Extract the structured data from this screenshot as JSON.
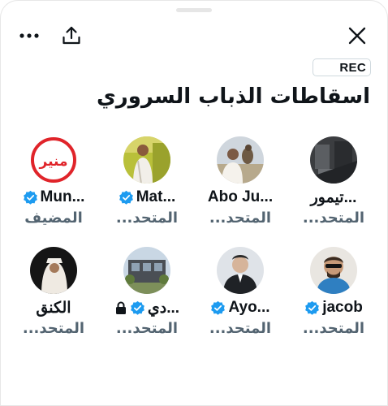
{
  "toolbar": {
    "more_icon": "more-horizontal-icon",
    "share_icon": "share-icon",
    "close_icon": "close-icon"
  },
  "rec_label": "REC",
  "space_title": "اسقاطات الذباب السروري",
  "colors": {
    "verified": "#1d9bf0",
    "role_text": "#536471",
    "text": "#0f1419"
  },
  "participants": [
    {
      "name": "Mun...",
      "role": "المضيف",
      "verified": true,
      "locked": false
    },
    {
      "name": "Mat...",
      "role": "المتحد...",
      "verified": true,
      "locked": false
    },
    {
      "name": "Abo Ju...",
      "role": "المتحد...",
      "verified": false,
      "locked": false
    },
    {
      "name": "تيمور...",
      "role": "المتحد...",
      "verified": false,
      "locked": false
    },
    {
      "name": "الكنق",
      "role": "المتحد...",
      "verified": false,
      "locked": false
    },
    {
      "name": "دي...",
      "role": "المتحد...",
      "verified": true,
      "locked": true
    },
    {
      "name": "Ayo...",
      "role": "المتحد...",
      "verified": true,
      "locked": false
    },
    {
      "name": "jacob",
      "role": "المتحد...",
      "verified": true,
      "locked": false
    }
  ],
  "avatar_logo_text": "منير"
}
